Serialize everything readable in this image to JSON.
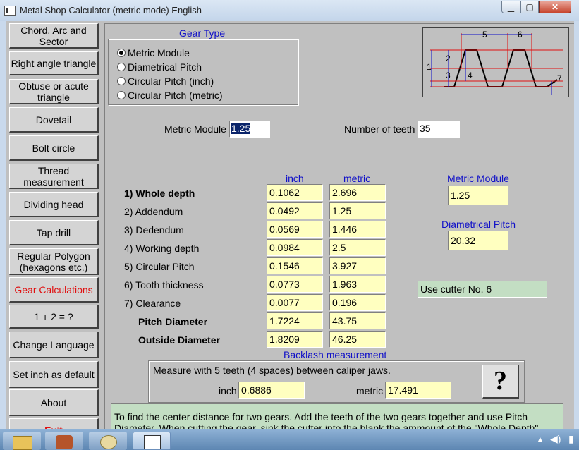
{
  "window": {
    "title": "Metal Shop Calculator (metric mode) English",
    "min": "▁",
    "max": "▢",
    "close": "✕"
  },
  "nav": [
    {
      "label": "Chord, Arc and Sector"
    },
    {
      "label": "Right angle triangle"
    },
    {
      "label": "Obtuse or acute triangle"
    },
    {
      "label": "Dovetail"
    },
    {
      "label": "Bolt circle"
    },
    {
      "label": "Thread measurement"
    },
    {
      "label": "Dividing head"
    },
    {
      "label": "Tap drill"
    },
    {
      "label": "Regular Polygon (hexagons etc.)"
    },
    {
      "label": "Gear Calculations",
      "active": true
    },
    {
      "label": "1 + 2 = ?"
    },
    {
      "label": "Change Language"
    },
    {
      "label": "Set inch as default"
    },
    {
      "label": "About"
    },
    {
      "label": "Exit"
    }
  ],
  "gear_type": {
    "title": "Gear Type",
    "options": [
      "Metric Module",
      "Diametrical Pitch",
      "Circular Pitch (inch)",
      "Circular Pitch (metric)"
    ],
    "selected": "Metric Module"
  },
  "diagram_labels": [
    "1",
    "2",
    "3",
    "4",
    "5",
    "6",
    "7"
  ],
  "inputs": {
    "module_label": "Metric Module",
    "module_value": "1.25",
    "teeth_label": "Number of teeth",
    "teeth_value": "35"
  },
  "results": {
    "col_inch": "inch",
    "col_metric": "metric",
    "rows": [
      {
        "label": "1) Whole depth",
        "inch": "0.1062",
        "metric": "2.696"
      },
      {
        "label": "2) Addendum",
        "inch": "0.0492",
        "metric": "1.25"
      },
      {
        "label": "3) Dedendum",
        "inch": "0.0569",
        "metric": "1.446"
      },
      {
        "label": "4) Working depth",
        "inch": "0.0984",
        "metric": "2.5"
      },
      {
        "label": "5) Circular Pitch",
        "inch": "0.1546",
        "metric": "3.927"
      },
      {
        "label": "6) Tooth thickness",
        "inch": "0.0773",
        "metric": "1.963"
      },
      {
        "label": "7) Clearance",
        "inch": "0.0077",
        "metric": "0.196"
      },
      {
        "label": "Pitch Diameter",
        "inch": "1.7224",
        "metric": "43.75"
      },
      {
        "label": "Outside Diameter",
        "inch": "1.8209",
        "metric": "46.25"
      }
    ]
  },
  "side": {
    "module_label": "Metric Module",
    "module_value": "1.25",
    "dp_label": "Diametrical Pitch",
    "dp_value": "20.32",
    "cutter": "Use cutter No. 6"
  },
  "backlash": {
    "title": "Backlash measurement",
    "text": "Measure with 5 teeth (4 spaces) between caliper jaws.",
    "inch_label": "inch",
    "inch_value": "0.6886",
    "metric_label": "metric",
    "metric_value": "17.491",
    "help": "?"
  },
  "info": "To find the center distance for two gears. Add the teeth of the two gears together and use Pitch Diameter. When cutting the gear, sink the cutter into the blank the ammount of the \"Whole Depth\"",
  "tray": {
    "time": ""
  }
}
